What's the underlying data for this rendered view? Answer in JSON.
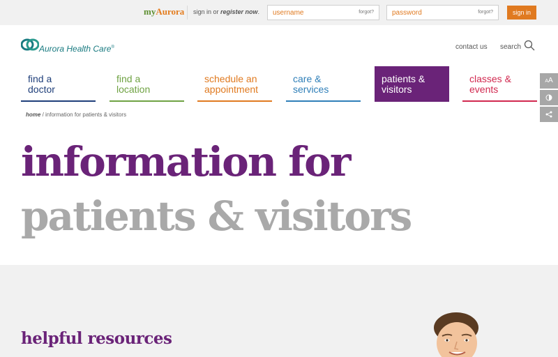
{
  "topbar": {
    "brand_prefix": "my",
    "brand_name": "Aurora",
    "signin_prefix": "sign in or ",
    "register": "register now",
    "signin_suffix": ".",
    "username_placeholder": "username",
    "username_forgot": "forgot?",
    "password_placeholder": "password",
    "password_forgot": "forgot?",
    "signin_button": "sign in"
  },
  "header": {
    "logo_text": "Aurora Health Care",
    "logo_mark": "®",
    "contact": "contact us",
    "search": "search"
  },
  "nav": [
    {
      "line1": "find a",
      "line2": "doctor",
      "color": "#1f3f7a"
    },
    {
      "line1": "find a",
      "line2": "location",
      "color": "#6fa243"
    },
    {
      "line1": "schedule an",
      "line2": "appointment",
      "color": "#e07a20"
    },
    {
      "line1": "care &",
      "line2": "services",
      "color": "#2f7fb8"
    },
    {
      "line1": "patients &",
      "line2": "visitors",
      "color": "#6a2378",
      "active": true
    },
    {
      "line1": "classes &",
      "line2": "events",
      "color": "#d1284f"
    }
  ],
  "side_tools": {
    "text_size_icon": "text-size-icon",
    "contrast_icon": "contrast-icon",
    "share_icon": "share-icon"
  },
  "breadcrumb": {
    "home": "home",
    "separator": " / ",
    "current": "information for patients & visitors"
  },
  "hero": {
    "line1": "information for",
    "line2": "patients & visitors"
  },
  "section": {
    "heading": "helpful resources"
  },
  "colors": {
    "purple": "#6a2378",
    "orange": "#e07a20",
    "teal": "#187a80",
    "gray_title": "#a9a9a9"
  }
}
